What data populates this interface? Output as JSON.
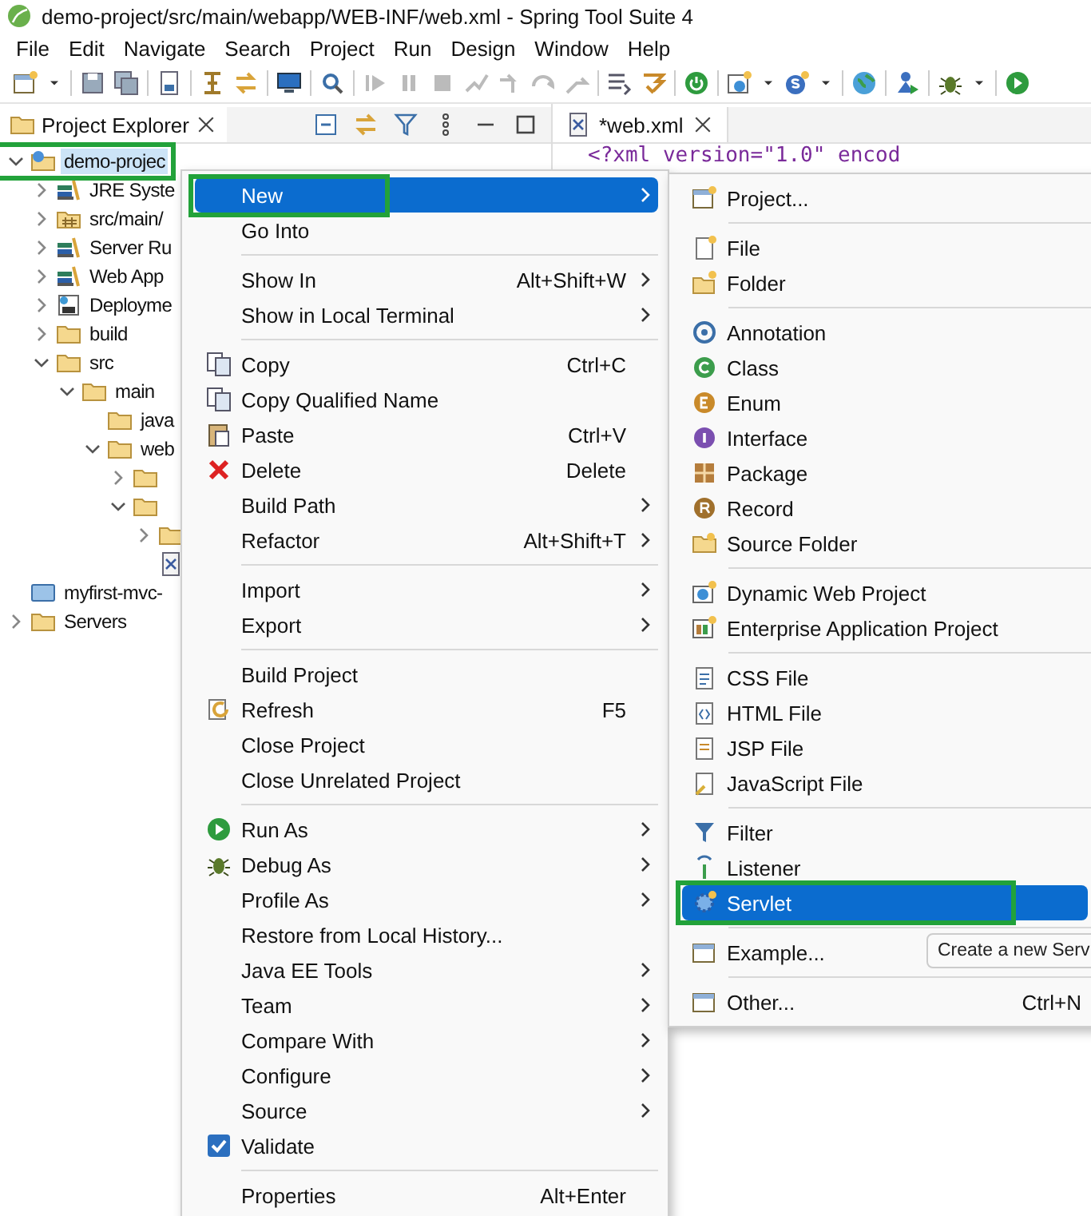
{
  "window": {
    "title": "demo-project/src/main/webapp/WEB-INF/web.xml - Spring Tool Suite 4"
  },
  "menu_bar": [
    "File",
    "Edit",
    "Navigate",
    "Search",
    "Project",
    "Run",
    "Design",
    "Window",
    "Help"
  ],
  "explorer": {
    "title": "Project Explorer",
    "tree": [
      {
        "label": "demo-projec",
        "kind": "project",
        "expanded": true,
        "selected": true,
        "highlighted": true,
        "children": [
          {
            "label": "JRE Syste",
            "kind": "library",
            "expanded": false,
            "selected": false,
            "highlighted": false
          },
          {
            "label": "src/main/",
            "kind": "source",
            "expanded": false,
            "selected": false,
            "highlighted": false
          },
          {
            "label": "Server Ru",
            "kind": "library",
            "expanded": false,
            "selected": false,
            "highlighted": false
          },
          {
            "label": "Web App",
            "kind": "library",
            "expanded": false,
            "selected": false,
            "highlighted": false
          },
          {
            "label": "Deployme",
            "kind": "descriptor",
            "expanded": false,
            "selected": false,
            "highlighted": false
          },
          {
            "label": "build",
            "kind": "folder",
            "expanded": false,
            "selected": false,
            "highlighted": false
          },
          {
            "label": "src",
            "kind": "folder",
            "expanded": true,
            "selected": false,
            "highlighted": false,
            "children": [
              {
                "label": "main",
                "kind": "folder",
                "expanded": true,
                "selected": false,
                "highlighted": false,
                "children": [
                  {
                    "label": "java",
                    "kind": "folder",
                    "selected": false,
                    "highlighted": false
                  },
                  {
                    "label": "web",
                    "kind": "folder",
                    "expanded": true,
                    "selected": false,
                    "highlighted": false,
                    "children": [
                      {
                        "kind": "folder",
                        "expanded": false,
                        "highlighted": false
                      },
                      {
                        "kind": "folder",
                        "expanded": true,
                        "highlighted": false,
                        "children": [
                          {
                            "kind": "folder",
                            "expanded": false,
                            "highlighted": false
                          },
                          {
                            "kind": "xml",
                            "highlighted": false
                          }
                        ]
                      }
                    ]
                  }
                ]
              }
            ]
          }
        ]
      },
      {
        "label": "myfirst-mvc-",
        "kind": "closed",
        "selected": false,
        "highlighted": false
      },
      {
        "label": "Servers",
        "kind": "folder",
        "expanded": false,
        "selected": false,
        "highlighted": false
      }
    ]
  },
  "editor": {
    "tab": "*web.xml",
    "code_line": "<?xml version=\"1.0\" encod"
  },
  "context_menu": [
    {
      "kind": "item",
      "label": "New",
      "submenu": true,
      "selected": true,
      "highlighted": true
    },
    {
      "kind": "item",
      "label": "Go Into",
      "selected": false,
      "highlighted": false
    },
    {
      "kind": "separator"
    },
    {
      "kind": "item",
      "label": "Show In",
      "shortcut": "Alt+Shift+W",
      "submenu": true,
      "selected": false,
      "highlighted": false
    },
    {
      "kind": "item",
      "label": "Show in Local Terminal",
      "submenu": true,
      "selected": false,
      "highlighted": false
    },
    {
      "kind": "separator"
    },
    {
      "kind": "item",
      "label": "Copy",
      "shortcut": "Ctrl+C",
      "selected": false,
      "highlighted": false
    },
    {
      "kind": "item",
      "label": "Copy Qualified Name",
      "selected": false,
      "highlighted": false
    },
    {
      "kind": "item",
      "label": "Paste",
      "shortcut": "Ctrl+V",
      "selected": false,
      "highlighted": false
    },
    {
      "kind": "item",
      "label": "Delete",
      "shortcut": "Delete",
      "selected": false,
      "highlighted": false
    },
    {
      "kind": "item",
      "label": "Build Path",
      "submenu": true,
      "selected": false,
      "highlighted": false
    },
    {
      "kind": "item",
      "label": "Refactor",
      "shortcut": "Alt+Shift+T",
      "submenu": true,
      "selected": false,
      "highlighted": false
    },
    {
      "kind": "separator"
    },
    {
      "kind": "item",
      "label": "Import",
      "submenu": true,
      "selected": false,
      "highlighted": false
    },
    {
      "kind": "item",
      "label": "Export",
      "submenu": true,
      "selected": false,
      "highlighted": false
    },
    {
      "kind": "separator"
    },
    {
      "kind": "item",
      "label": "Build Project",
      "selected": false,
      "highlighted": false
    },
    {
      "kind": "item",
      "label": "Refresh",
      "shortcut": "F5",
      "selected": false,
      "highlighted": false
    },
    {
      "kind": "item",
      "label": "Close Project",
      "selected": false,
      "highlighted": false
    },
    {
      "kind": "item",
      "label": "Close Unrelated Project",
      "selected": false,
      "highlighted": false
    },
    {
      "kind": "separator"
    },
    {
      "kind": "item",
      "label": "Run As",
      "submenu": true,
      "selected": false,
      "highlighted": false
    },
    {
      "kind": "item",
      "label": "Debug As",
      "submenu": true,
      "selected": false,
      "highlighted": false
    },
    {
      "kind": "item",
      "label": "Profile As",
      "submenu": true,
      "selected": false,
      "highlighted": false
    },
    {
      "kind": "item",
      "label": "Restore from Local History...",
      "selected": false,
      "highlighted": false
    },
    {
      "kind": "item",
      "label": "Java EE Tools",
      "submenu": true,
      "selected": false,
      "highlighted": false
    },
    {
      "kind": "item",
      "label": "Team",
      "submenu": true,
      "selected": false,
      "highlighted": false
    },
    {
      "kind": "item",
      "label": "Compare With",
      "submenu": true,
      "selected": false,
      "highlighted": false
    },
    {
      "kind": "item",
      "label": "Configure",
      "submenu": true,
      "selected": false,
      "highlighted": false
    },
    {
      "kind": "item",
      "label": "Source",
      "submenu": true,
      "selected": false,
      "highlighted": false
    },
    {
      "kind": "item",
      "label": "Validate",
      "selected": false,
      "highlighted": false
    },
    {
      "kind": "separator"
    },
    {
      "kind": "item",
      "label": "Properties",
      "shortcut": "Alt+Enter",
      "selected": false,
      "highlighted": false
    }
  ],
  "submenu": [
    {
      "kind": "item",
      "label": "Project...",
      "selected": false,
      "highlighted": false
    },
    {
      "kind": "separator"
    },
    {
      "kind": "item",
      "label": "File",
      "selected": false,
      "highlighted": false
    },
    {
      "kind": "item",
      "label": "Folder",
      "selected": false,
      "highlighted": false
    },
    {
      "kind": "separator"
    },
    {
      "kind": "item",
      "label": "Annotation",
      "selected": false,
      "highlighted": false
    },
    {
      "kind": "item",
      "label": "Class",
      "selected": false,
      "highlighted": false
    },
    {
      "kind": "item",
      "label": "Enum",
      "selected": false,
      "highlighted": false
    },
    {
      "kind": "item",
      "label": "Interface",
      "selected": false,
      "highlighted": false
    },
    {
      "kind": "item",
      "label": "Package",
      "selected": false,
      "highlighted": false
    },
    {
      "kind": "item",
      "label": "Record",
      "selected": false,
      "highlighted": false
    },
    {
      "kind": "item",
      "label": "Source Folder",
      "selected": false,
      "highlighted": false
    },
    {
      "kind": "separator"
    },
    {
      "kind": "item",
      "label": "Dynamic Web Project",
      "selected": false,
      "highlighted": false
    },
    {
      "kind": "item",
      "label": "Enterprise Application Project",
      "selected": false,
      "highlighted": false
    },
    {
      "kind": "separator"
    },
    {
      "kind": "item",
      "label": "CSS File",
      "selected": false,
      "highlighted": false
    },
    {
      "kind": "item",
      "label": "HTML File",
      "selected": false,
      "highlighted": false
    },
    {
      "kind": "item",
      "label": "JSP File",
      "selected": false,
      "highlighted": false
    },
    {
      "kind": "item",
      "label": "JavaScript File",
      "selected": false,
      "highlighted": false
    },
    {
      "kind": "separator"
    },
    {
      "kind": "item",
      "label": "Filter",
      "selected": false,
      "highlighted": false
    },
    {
      "kind": "item",
      "label": "Listener",
      "selected": false,
      "highlighted": false
    },
    {
      "kind": "item",
      "label": "Servlet",
      "selected": true,
      "highlighted": true
    },
    {
      "kind": "separator"
    },
    {
      "kind": "item",
      "label": "Example...",
      "selected": false,
      "highlighted": false
    },
    {
      "kind": "separator"
    },
    {
      "kind": "item",
      "label": "Other...",
      "shortcut": "Ctrl+N",
      "selected": false,
      "highlighted": false
    }
  ],
  "tooltip": "Create a new Serv"
}
